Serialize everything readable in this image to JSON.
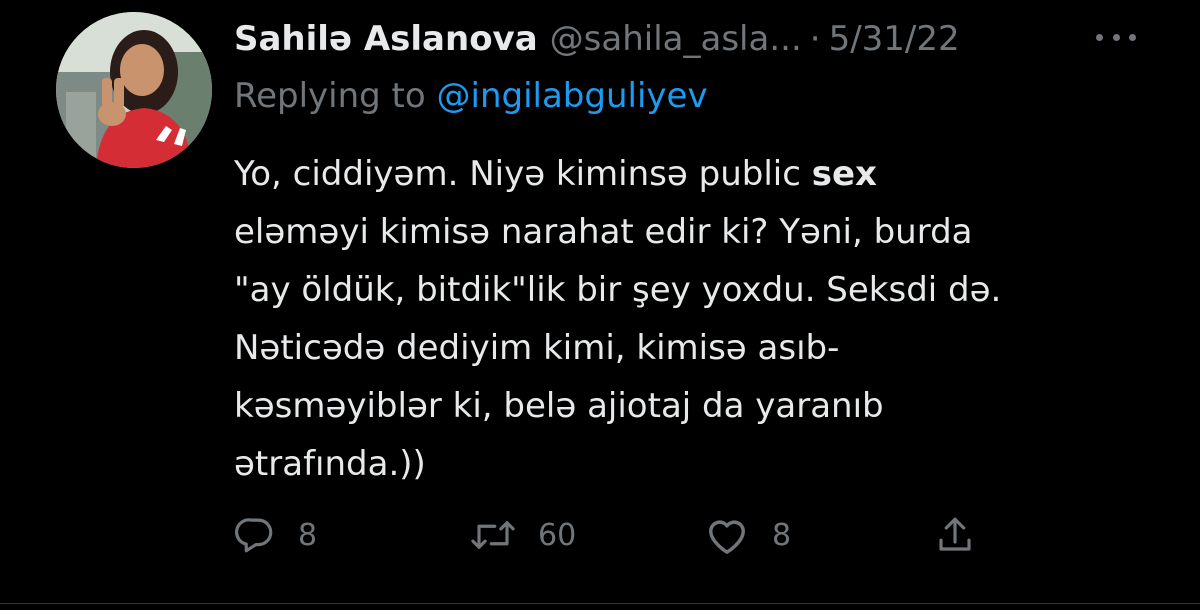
{
  "tweet": {
    "display_name": "Sahilə Aslanova",
    "handle": "@sahila_asla...",
    "separator": "·",
    "date": "5/31/22",
    "replying_prefix": "Replying to",
    "replying_to": "@ingilabguliyev",
    "text_lines": [
      {
        "pre": "Yo, ciddiyəm. Niyə kiminsə public ",
        "bold": "sex",
        "post": ""
      },
      {
        "pre": "eləməyi kimisə narahat edir ki? Yəni, burda",
        "bold": "",
        "post": ""
      },
      {
        "pre": "\"ay öldük, bitdik\"lik bir şey yoxdu. Seksdi də.",
        "bold": "",
        "post": ""
      },
      {
        "pre": "Nəticədə dediyim kimi, kimisə asıb-",
        "bold": "",
        "post": ""
      },
      {
        "pre": "kəsməyiblər ki, belə ajiotaj da yaranıb",
        "bold": "",
        "post": ""
      },
      {
        "pre": "ətrafında.))",
        "bold": "",
        "post": ""
      }
    ]
  },
  "actions": {
    "reply": {
      "icon": "reply-icon",
      "count": "8"
    },
    "retweet": {
      "icon": "retweet-icon",
      "count": "60"
    },
    "like": {
      "icon": "heart-icon",
      "count": "8"
    },
    "share": {
      "icon": "share-icon"
    }
  },
  "colors": {
    "background": "#000000",
    "primary_text": "#e7e9ea",
    "secondary_text": "#71767b",
    "link": "#1d9bf0"
  }
}
